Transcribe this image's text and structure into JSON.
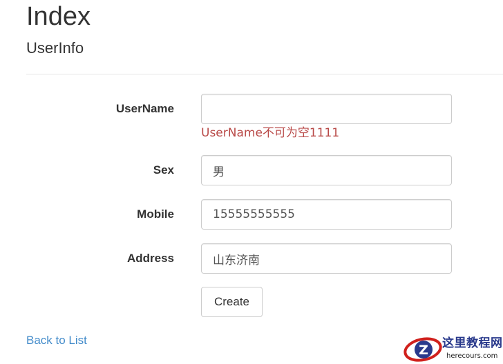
{
  "page": {
    "title": "Index",
    "subtitle": "UserInfo"
  },
  "form": {
    "fields": [
      {
        "label": "UserName",
        "value": "",
        "error": "UserName不可为空1111"
      },
      {
        "label": "Sex",
        "value": "男"
      },
      {
        "label": "Mobile",
        "value": "15555555555"
      },
      {
        "label": "Address",
        "value": "山东济南"
      }
    ],
    "submit_label": "Create"
  },
  "footer": {
    "back_link": "Back to List"
  },
  "watermark": {
    "site_name": "这里教程网",
    "url": "herecours.com",
    "logo_letter": "Z",
    "colors": {
      "logo_red": "#d0201c",
      "logo_blue": "#2a3a8c"
    }
  },
  "colors": {
    "link": "#428bca",
    "error": "#b94a48",
    "input_border": "#cccccc",
    "rule": "#e5e5e5"
  }
}
